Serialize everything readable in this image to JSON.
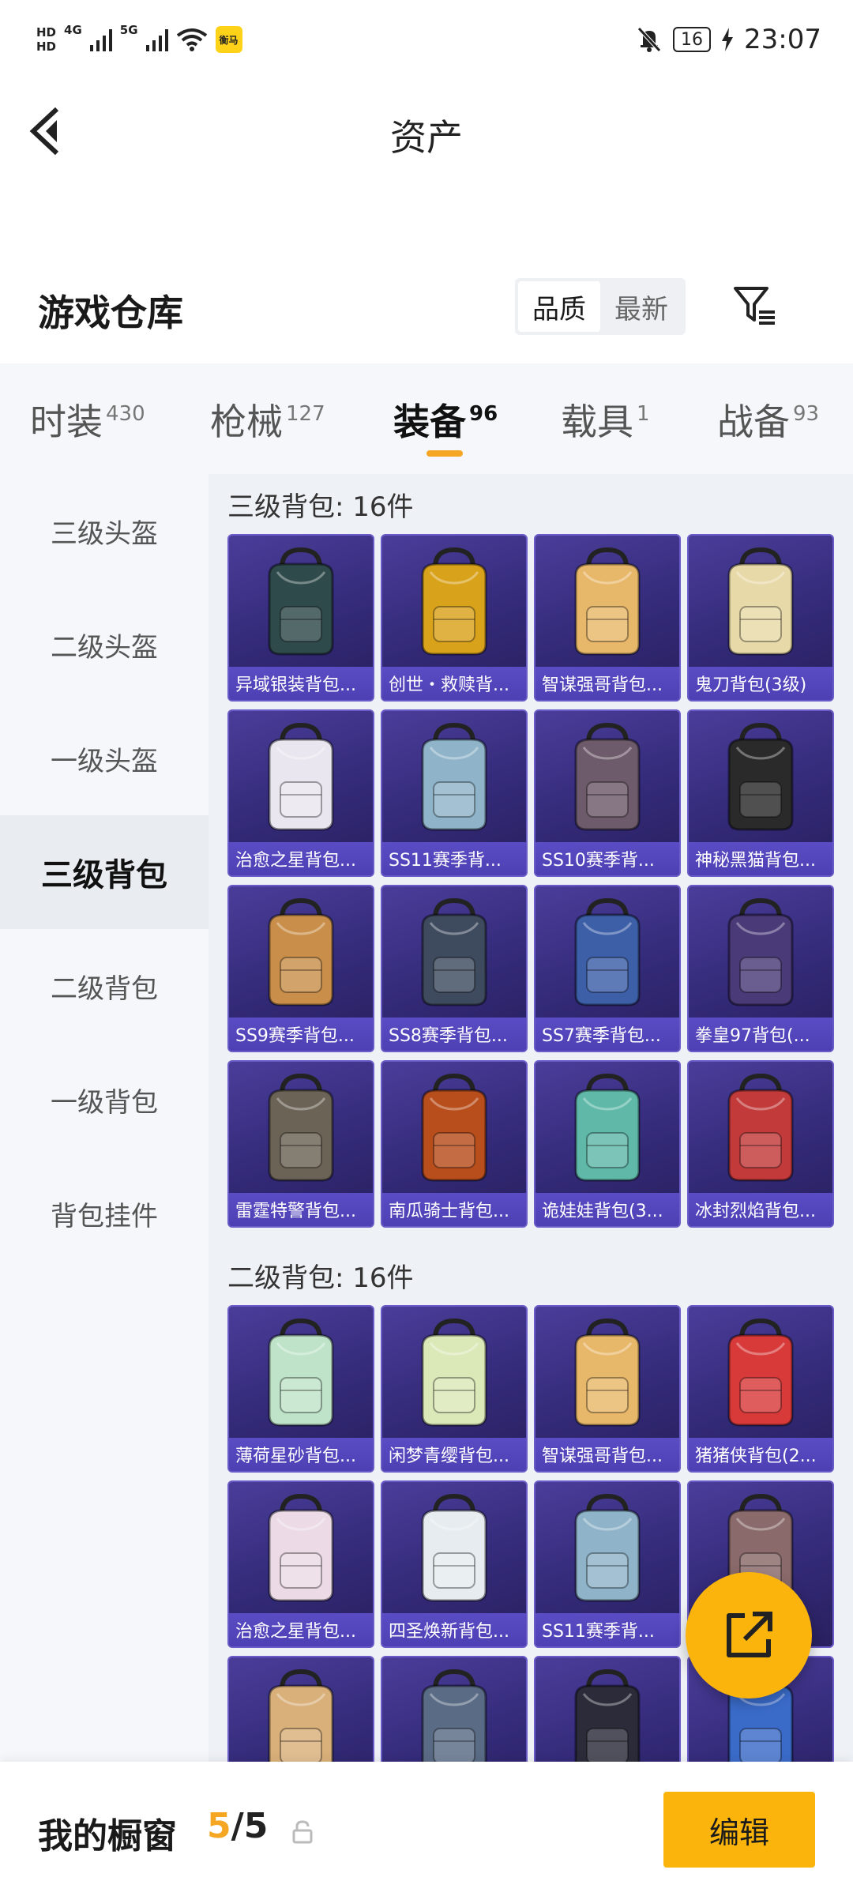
{
  "status_bar": {
    "hd1": "HD",
    "hd2": "HD",
    "net1": "4G",
    "net2": "5G",
    "app_badge": "衡马",
    "battery": "16",
    "time": "23:07"
  },
  "header": {
    "title": "资产"
  },
  "warehouse": {
    "title": "游戏仓库",
    "sort": [
      {
        "label": "品质",
        "active": true
      },
      {
        "label": "最新",
        "active": false
      }
    ]
  },
  "categories": [
    {
      "label": "时装",
      "count": "430"
    },
    {
      "label": "枪械",
      "count": "127"
    },
    {
      "label": "装备",
      "count": "96",
      "active": true
    },
    {
      "label": "载具",
      "count": "1"
    },
    {
      "label": "战备",
      "count": "93"
    }
  ],
  "sidebar": {
    "items": [
      {
        "label": "三级头盔"
      },
      {
        "label": "二级头盔"
      },
      {
        "label": "一级头盔"
      },
      {
        "label": "三级背包",
        "active": true
      },
      {
        "label": "二级背包"
      },
      {
        "label": "一级背包"
      },
      {
        "label": "背包挂件"
      }
    ]
  },
  "sections": [
    {
      "title": "三级背包: 16件",
      "items": [
        {
          "name": "异域银装背包...",
          "color": "#2f4a4a"
        },
        {
          "name": "创世・救赎背...",
          "color": "#d9a21b"
        },
        {
          "name": "智谋强哥背包...",
          "color": "#e8b86a"
        },
        {
          "name": "鬼刀背包(3级)",
          "color": "#e8d9a8"
        },
        {
          "name": "治愈之星背包...",
          "color": "#e9e6ef"
        },
        {
          "name": "SS11赛季背...",
          "color": "#8fb4c9"
        },
        {
          "name": "SS10赛季背...",
          "color": "#6d5a6a"
        },
        {
          "name": "神秘黑猫背包...",
          "color": "#2a2a2a"
        },
        {
          "name": "SS9赛季背包...",
          "color": "#c98f4a"
        },
        {
          "name": "SS8赛季背包...",
          "color": "#3e4b5e"
        },
        {
          "name": "SS7赛季背包...",
          "color": "#3c5fa8"
        },
        {
          "name": "拳皇97背包(...",
          "color": "#4a3a78"
        },
        {
          "name": "雷霆特警背包...",
          "color": "#6b6355"
        },
        {
          "name": "南瓜骑士背包...",
          "color": "#b84e1c"
        },
        {
          "name": "诡娃娃背包(3...",
          "color": "#5fb8a8"
        },
        {
          "name": "冰封烈焰背包...",
          "color": "#c23a3a"
        }
      ]
    },
    {
      "title": "二级背包: 16件",
      "items": [
        {
          "name": "薄荷星砂背包...",
          "color": "#bfe3c9"
        },
        {
          "name": "闲梦青缨背包...",
          "color": "#dbe8b8"
        },
        {
          "name": "智谋强哥背包...",
          "color": "#e8b86a"
        },
        {
          "name": "猪猪侠背包(2...",
          "color": "#d83a3a"
        },
        {
          "name": "治愈之星背包...",
          "color": "#ecdbe6"
        },
        {
          "name": "四圣焕新背包...",
          "color": "#e6ecf0"
        },
        {
          "name": "SS11赛季背...",
          "color": "#8fb4c9"
        },
        {
          "name": "",
          "color": "#8a6a6a"
        },
        {
          "name": "",
          "color": "#d9b07a"
        },
        {
          "name": "",
          "color": "#5a6b85"
        },
        {
          "name": "",
          "color": "#2b2b3a"
        },
        {
          "name": "",
          "color": "#3a6bc9"
        }
      ]
    }
  ],
  "bottom_bar": {
    "label": "我的橱窗",
    "count_current": "5",
    "count_sep": "/",
    "count_total": "5",
    "edit_label": "编辑"
  }
}
